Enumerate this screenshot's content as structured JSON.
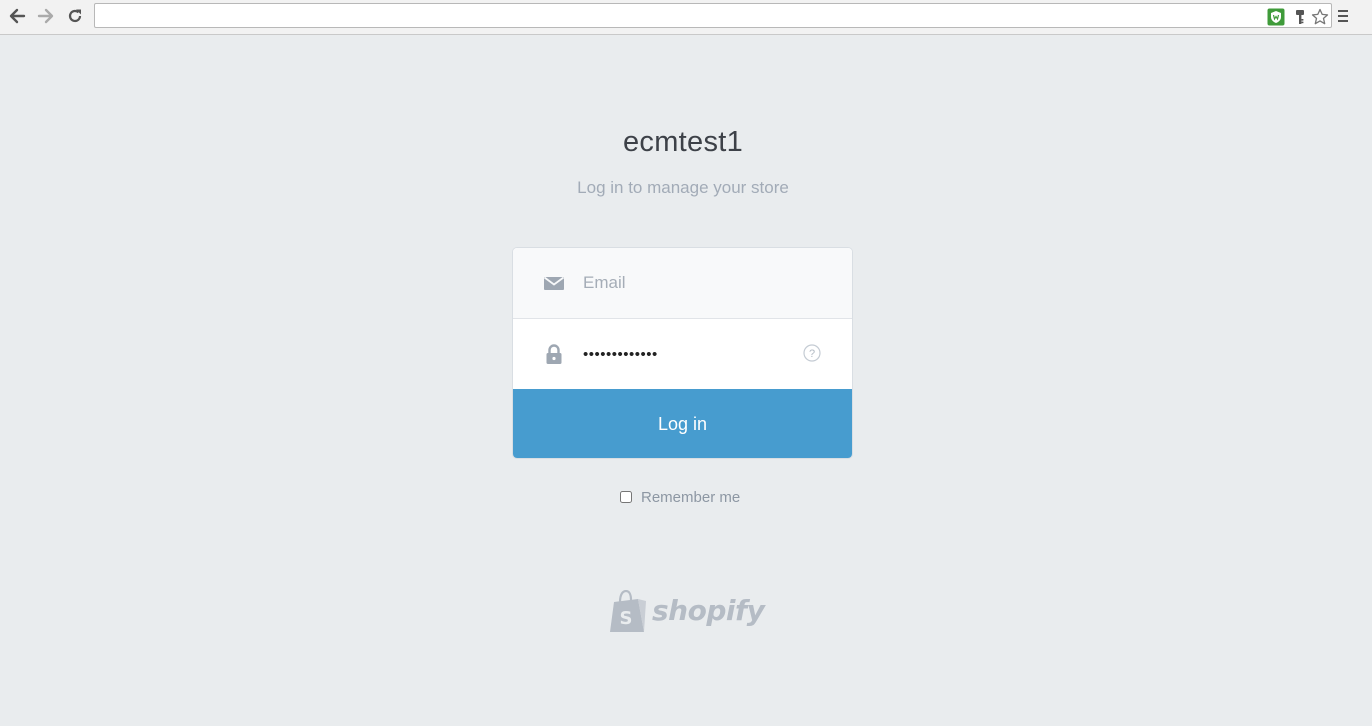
{
  "browser": {
    "back_label": "Back",
    "forward_label": "Forward",
    "reload_label": "Reload",
    "address_value": "",
    "icons": [
      "arrow-left-icon",
      "arrow-right-icon",
      "reload-icon",
      "shield-extension-icon",
      "key-icon",
      "star-icon",
      "menu-icon"
    ]
  },
  "header": {
    "store_name": "ecmtest1",
    "subtitle": "Log in to manage your store"
  },
  "form": {
    "email_placeholder": "Email",
    "email_value": "",
    "password_value": "•••••••••••••",
    "login_label": "Log in",
    "remember_label": "Remember me",
    "remember_checked": false
  },
  "footer": {
    "logo_text": "shopify"
  },
  "colors": {
    "background": "#e9ecee",
    "button": "#479ccf",
    "subtitle": "#a2abb7",
    "icon": "#9ea7b2"
  }
}
